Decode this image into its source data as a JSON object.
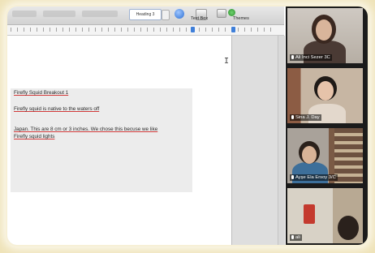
{
  "toolbar": {
    "heading_style": "Heading 3",
    "text_box_label": "Text Box",
    "themes_label": "Themes"
  },
  "document": {
    "line1": "Firefly Squid Breakout 1",
    "line2": "Firefly squid is native to the waters off",
    "line3": "Japan. This are 8 cm or 3 inches. We chose this becuse we like",
    "line4": "Firefly squid lights"
  },
  "participants": [
    {
      "name": "Ali Inci Sezer 3C"
    },
    {
      "name": "Sina J. Day"
    },
    {
      "name": "Ayşe Ela Ersoy 3/C"
    },
    {
      "name": "ali"
    }
  ],
  "colors": {
    "active_speaker_border": "#b7e34a",
    "underline": "#d23a3a",
    "frame_background": "#efe3b8"
  }
}
